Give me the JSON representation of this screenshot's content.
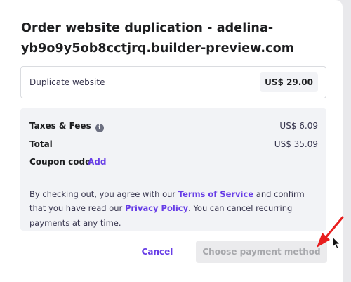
{
  "modal": {
    "title_line1": "Order website duplication - adelina-",
    "title_line2": "yb9o9y5ob8cctjrq.builder-preview.com"
  },
  "item": {
    "label": "Duplicate website",
    "price": "US$ 29.00"
  },
  "summary": {
    "taxes_label": "Taxes & Fees",
    "taxes_info_icon": "info-icon",
    "taxes_value": "US$ 6.09",
    "total_label": "Total",
    "total_value": "US$ 35.09",
    "coupon_label": "Coupon code",
    "coupon_action": "Add"
  },
  "legal": {
    "part1": "By checking out, you agree with our ",
    "terms_link": "Terms of Service",
    "part2": " and confirm that you have read our ",
    "privacy_link": "Privacy Policy",
    "part3": ". You can cancel recurring payments at any time."
  },
  "actions": {
    "cancel_label": "Cancel",
    "payment_label": "Choose payment method"
  },
  "annotation": {
    "arrow_color": "#e81e1e",
    "cursor_icon": "mouse-pointer-icon"
  },
  "colors": {
    "accent": "#673de6",
    "panel_bg": "#f2f3f6",
    "disabled_bg": "#ebebed",
    "disabled_text": "#a6a7ab"
  }
}
